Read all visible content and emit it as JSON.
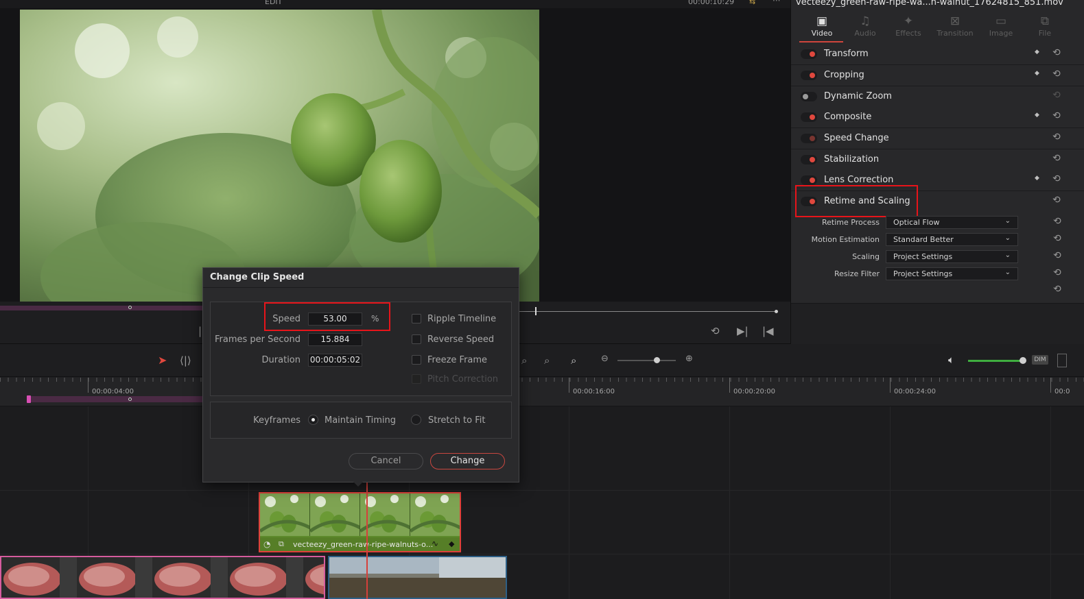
{
  "viewer": {
    "mode_label": "EDIT",
    "timecode": "00:00:10:29"
  },
  "inspector": {
    "clip_name": "vecteezy_green-raw-ripe-wa...n-walnut_17624815_851.mov",
    "tabs": [
      {
        "label": "Video",
        "icon": "video-icon",
        "active": true
      },
      {
        "label": "Audio",
        "icon": "audio-icon",
        "active": false
      },
      {
        "label": "Effects",
        "icon": "effects-icon",
        "active": false
      },
      {
        "label": "Transition",
        "icon": "transition-icon",
        "active": false
      },
      {
        "label": "Image",
        "icon": "image-icon",
        "active": false
      },
      {
        "label": "File",
        "icon": "file-icon",
        "active": false
      }
    ],
    "sections": [
      {
        "label": "Transform",
        "enabled": true,
        "keyframe": true
      },
      {
        "label": "Cropping",
        "enabled": true,
        "keyframe": true
      },
      {
        "label": "Dynamic Zoom",
        "enabled": false,
        "keyframe": false
      },
      {
        "label": "Composite",
        "enabled": true,
        "keyframe": true
      },
      {
        "label": "Speed Change",
        "enabled": true,
        "keyframe": false
      },
      {
        "label": "Stabilization",
        "enabled": true,
        "keyframe": false
      },
      {
        "label": "Lens Correction",
        "enabled": true,
        "keyframe": true
      },
      {
        "label": "Retime and Scaling",
        "enabled": true,
        "keyframe": false
      }
    ],
    "retime": [
      {
        "label": "Retime Process",
        "value": "Optical Flow"
      },
      {
        "label": "Motion Estimation",
        "value": "Standard Better"
      },
      {
        "label": "Scaling",
        "value": "Project Settings"
      },
      {
        "label": "Resize Filter",
        "value": "Project Settings"
      }
    ]
  },
  "timeline": {
    "ruler_labels": [
      "00:00:04:00",
      "00:00:16:00",
      "00:00:20:00",
      "00:00:24:00",
      "00:0"
    ],
    "video_clip_label": "vecteezy_green-raw-ripe-walnuts-o..."
  },
  "dialog": {
    "title": "Change Clip Speed",
    "speed_label": "Speed",
    "speed_value": "53.00",
    "speed_unit": "%",
    "fps_label": "Frames per Second",
    "fps_value": "15.884",
    "duration_label": "Duration",
    "duration_value": "00:00:05:02",
    "options": [
      {
        "label": "Ripple Timeline",
        "checked": false,
        "disabled": false
      },
      {
        "label": "Reverse Speed",
        "checked": false,
        "disabled": false
      },
      {
        "label": "Freeze Frame",
        "checked": false,
        "disabled": false
      },
      {
        "label": "Pitch Correction",
        "checked": false,
        "disabled": true
      }
    ],
    "keyframes_label": "Keyframes",
    "keyframe_modes": [
      {
        "label": "Maintain Timing",
        "selected": true
      },
      {
        "label": "Stretch to Fit",
        "selected": false
      }
    ],
    "cancel_label": "Cancel",
    "change_label": "Change"
  },
  "colors": {
    "accent": "#e0483e",
    "highlight_box": "#e8141a",
    "video_clip": "#5d8a2c",
    "audio_level": "#3fae3f"
  },
  "toolbar": {
    "dim_label": "DIM"
  }
}
